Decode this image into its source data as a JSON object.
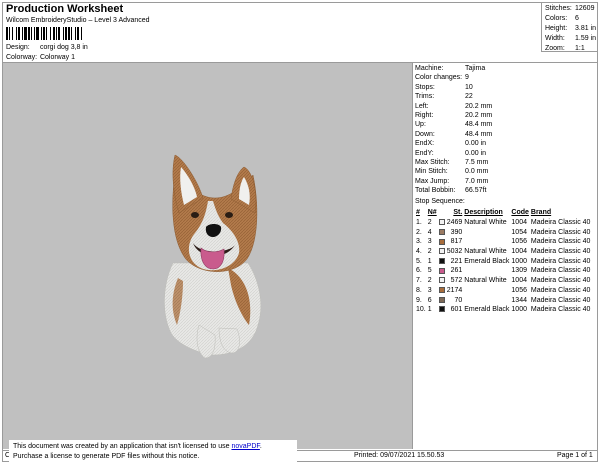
{
  "header": {
    "title": "Production Worksheet",
    "subtitle": "Wilcom EmbroideryStudio – Level 3 Advanced",
    "design_label": "Design:",
    "design_value": "corgi dog 3,8 in",
    "colorway_label": "Colorway:",
    "colorway_value": "Colorway 1"
  },
  "stats": [
    {
      "k": "Stitches:",
      "v": "12609"
    },
    {
      "k": "Colors:",
      "v": "6"
    },
    {
      "k": "Height:",
      "v": "3.81 in"
    },
    {
      "k": "Width:",
      "v": "1.59 in"
    },
    {
      "k": "Zoom:",
      "v": "1:1"
    }
  ],
  "info": [
    {
      "k": "Machine:",
      "v": "Tajima"
    },
    {
      "k": "Color changes:",
      "v": "9"
    },
    {
      "k": "Stops:",
      "v": "10"
    },
    {
      "k": "Trims:",
      "v": "22"
    },
    {
      "k": "Left:",
      "v": "20.2 mm"
    },
    {
      "k": "Right:",
      "v": "20.2 mm"
    },
    {
      "k": "Up:",
      "v": "48.4 mm"
    },
    {
      "k": "Down:",
      "v": "48.4 mm"
    },
    {
      "k": "EndX:",
      "v": "0.00 in"
    },
    {
      "k": "EndY:",
      "v": "0.00 in"
    },
    {
      "k": "Max Stitch:",
      "v": "7.5 mm"
    },
    {
      "k": "Min Stitch:",
      "v": "0.0 mm"
    },
    {
      "k": "Max Jump:",
      "v": "7.0 mm"
    },
    {
      "k": "Total Bobbin:",
      "v": "66.57ft"
    }
  ],
  "sequence": {
    "label": "Stop Sequence:",
    "headers": [
      "#",
      "N#",
      "",
      "St.",
      "Description",
      "Code",
      "Brand"
    ],
    "rows": [
      {
        "i": "1.",
        "n": "2",
        "color": "#f2f2f2",
        "st": "2469",
        "desc": "Natural White",
        "code": "1004",
        "brand": "Madeira Classic 40"
      },
      {
        "i": "2.",
        "n": "4",
        "color": "#9b7b63",
        "st": "390",
        "desc": "",
        "code": "1054",
        "brand": "Madeira Classic 40"
      },
      {
        "i": "3.",
        "n": "3",
        "color": "#a86d3c",
        "st": "817",
        "desc": "",
        "code": "1056",
        "brand": "Madeira Classic 40"
      },
      {
        "i": "4.",
        "n": "2",
        "color": "#f2f2f2",
        "st": "5032",
        "desc": "Natural White",
        "code": "1004",
        "brand": "Madeira Classic 40"
      },
      {
        "i": "5.",
        "n": "1",
        "color": "#111111",
        "st": "221",
        "desc": "Emerald Black",
        "code": "1000",
        "brand": "Madeira Classic 40"
      },
      {
        "i": "6.",
        "n": "5",
        "color": "#c95b8d",
        "st": "261",
        "desc": "",
        "code": "1309",
        "brand": "Madeira Classic 40"
      },
      {
        "i": "7.",
        "n": "2",
        "color": "#f2f2f2",
        "st": "572",
        "desc": "Natural White",
        "code": "1004",
        "brand": "Madeira Classic 40"
      },
      {
        "i": "8.",
        "n": "3",
        "color": "#a86d3c",
        "st": "2174",
        "desc": "",
        "code": "1056",
        "brand": "Madeira Classic 40"
      },
      {
        "i": "9.",
        "n": "6",
        "color": "#7d6a58",
        "st": "70",
        "desc": "",
        "code": "1344",
        "brand": "Madeira Classic 40"
      },
      {
        "i": "10.",
        "n": "1",
        "color": "#111111",
        "st": "601",
        "desc": "Emerald Black",
        "code": "1000",
        "brand": "Madeira Classic 40"
      }
    ]
  },
  "notice": {
    "line1": "This document was created by an application that isn't licensed to use ",
    "link": "novaPDF",
    "line1_end": ".",
    "line2": "Purchase a license to generate PDF files without this notice."
  },
  "footer": {
    "left": "Cr",
    "printed": "Printed: 09/07/2021 15.50.53",
    "page": "Page 1 of 1"
  },
  "colors": {
    "background_gray": "#c0c0c0",
    "fur_white": "#ececec",
    "fur_brown": "#b07a4a",
    "tongue": "#c95b8d"
  }
}
